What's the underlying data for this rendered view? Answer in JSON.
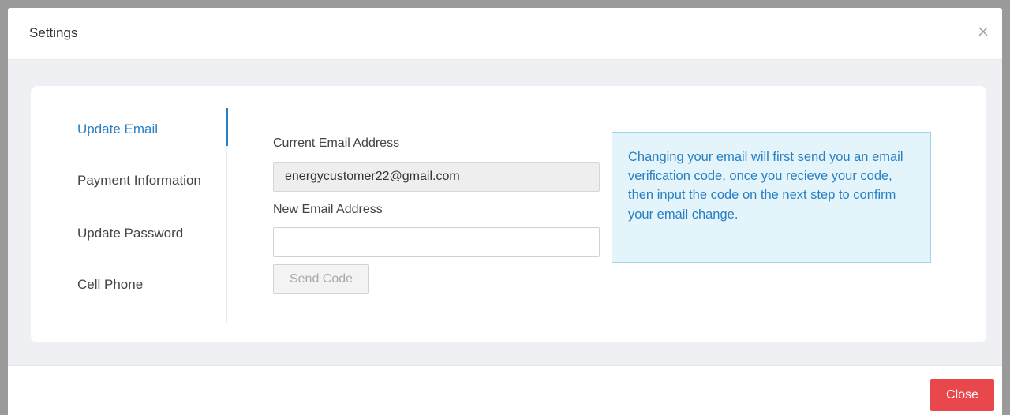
{
  "modal": {
    "title": "Settings",
    "close_icon": "close-icon"
  },
  "nav": {
    "active_index": 0,
    "items": [
      {
        "label": "Update Email",
        "active": true
      },
      {
        "label": "Payment Information",
        "active": false
      },
      {
        "label": "Update Password",
        "active": false
      },
      {
        "label": "Cell Phone",
        "active": false
      }
    ]
  },
  "form": {
    "current_email_label": "Current Email Address",
    "current_email_value": "energycustomer22@gmail.com",
    "new_email_label": "New Email Address",
    "new_email_value": "",
    "send_code_label": "Send Code",
    "send_code_disabled": true
  },
  "info": {
    "text": "Changing your email will first send you an email verification code, once you recieve your code, then input the code on the next step to confirm your email change."
  },
  "footer": {
    "close_label": "Close"
  },
  "colors": {
    "accent": "#2a7fc2",
    "danger": "#e8474b",
    "info_bg": "#e3f4fb",
    "info_border": "#9fd5eb"
  }
}
